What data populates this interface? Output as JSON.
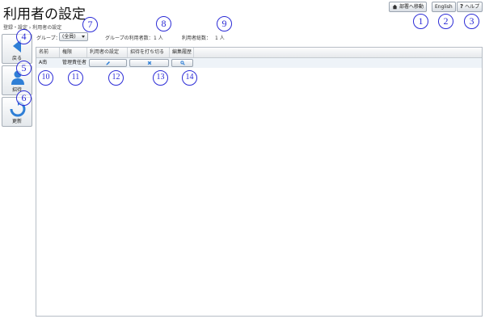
{
  "page": {
    "title": "利用者の設定",
    "breadcrumb": "登録・設定 › 利用者の設定"
  },
  "top_buttons": {
    "move_dept": "部署へ移動",
    "english": "English",
    "help": "ヘルプ"
  },
  "side_buttons": {
    "back": "戻る",
    "invite": "招待",
    "refresh": "更新"
  },
  "group": {
    "label": "グループ：",
    "selected": "(全員)",
    "member_count_label": "グループの利用者数：",
    "member_count": "1 人",
    "total_label": "利用者総数：",
    "total": "1 人"
  },
  "table": {
    "headers": [
      "名前",
      "権限",
      "利用者の設定",
      "招待を打ち切る",
      "編集履歴"
    ],
    "rows": [
      {
        "name": "A南",
        "role": "管理責任者"
      }
    ]
  },
  "annotations": [
    "1",
    "2",
    "3",
    "4",
    "5",
    "6",
    "7",
    "8",
    "9",
    "10",
    "11",
    "12",
    "13",
    "14"
  ],
  "colors": {
    "annotation": "#2b2bd6",
    "row_bg": "#eef3f8",
    "accent_blue": "#2f7fd6"
  }
}
